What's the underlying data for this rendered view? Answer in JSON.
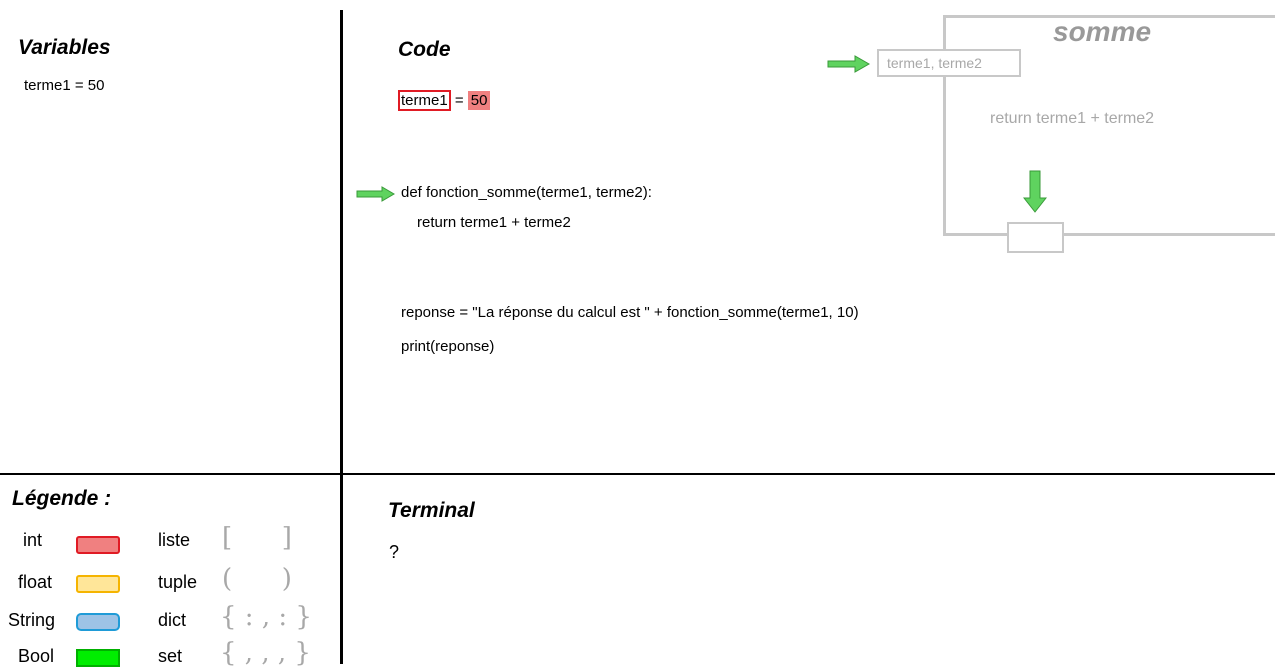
{
  "panels": {
    "variables_title": "Variables",
    "code_title": "Code",
    "legend_title": "Légende :",
    "terminal_title": "Terminal"
  },
  "variables": {
    "line1": "terme1 = 50"
  },
  "code": {
    "assign_var": "terme1",
    "assign_eq": " = ",
    "assign_val": "50",
    "def_line": "def fonction_somme(terme1, terme2):",
    "return_line": "return terme1 + terme2",
    "reponse_line": "reponse = \"La réponse du calcul est \" + fonction_somme(terme1, 10)",
    "print_line": "print(reponse)"
  },
  "function_box": {
    "name": "somme",
    "params": "terme1, terme2",
    "body": "return terme1 + terme2"
  },
  "terminal": {
    "output": "?"
  },
  "legend": {
    "types": [
      {
        "label": "int",
        "color": "#f08080",
        "border": "#e01b24"
      },
      {
        "label": "float",
        "color": "#ffe699",
        "border": "#f5b400"
      },
      {
        "label": "String",
        "color": "#9dc3e6",
        "border": "#1f9bd7"
      },
      {
        "label": "Bool",
        "color": "#00ee00",
        "border": "#00b000"
      }
    ],
    "collections": [
      {
        "label": "liste",
        "symbol": "[      ]"
      },
      {
        "label": "tuple",
        "symbol": "(      )"
      },
      {
        "label": "dict",
        "symbol": "{ : , : }"
      },
      {
        "label": "set",
        "symbol": "{ , , , }"
      }
    ]
  },
  "colors": {
    "arrow": "#5fd35f",
    "arrow_border": "#3a9a3a",
    "faded": "#a8a8a8"
  }
}
